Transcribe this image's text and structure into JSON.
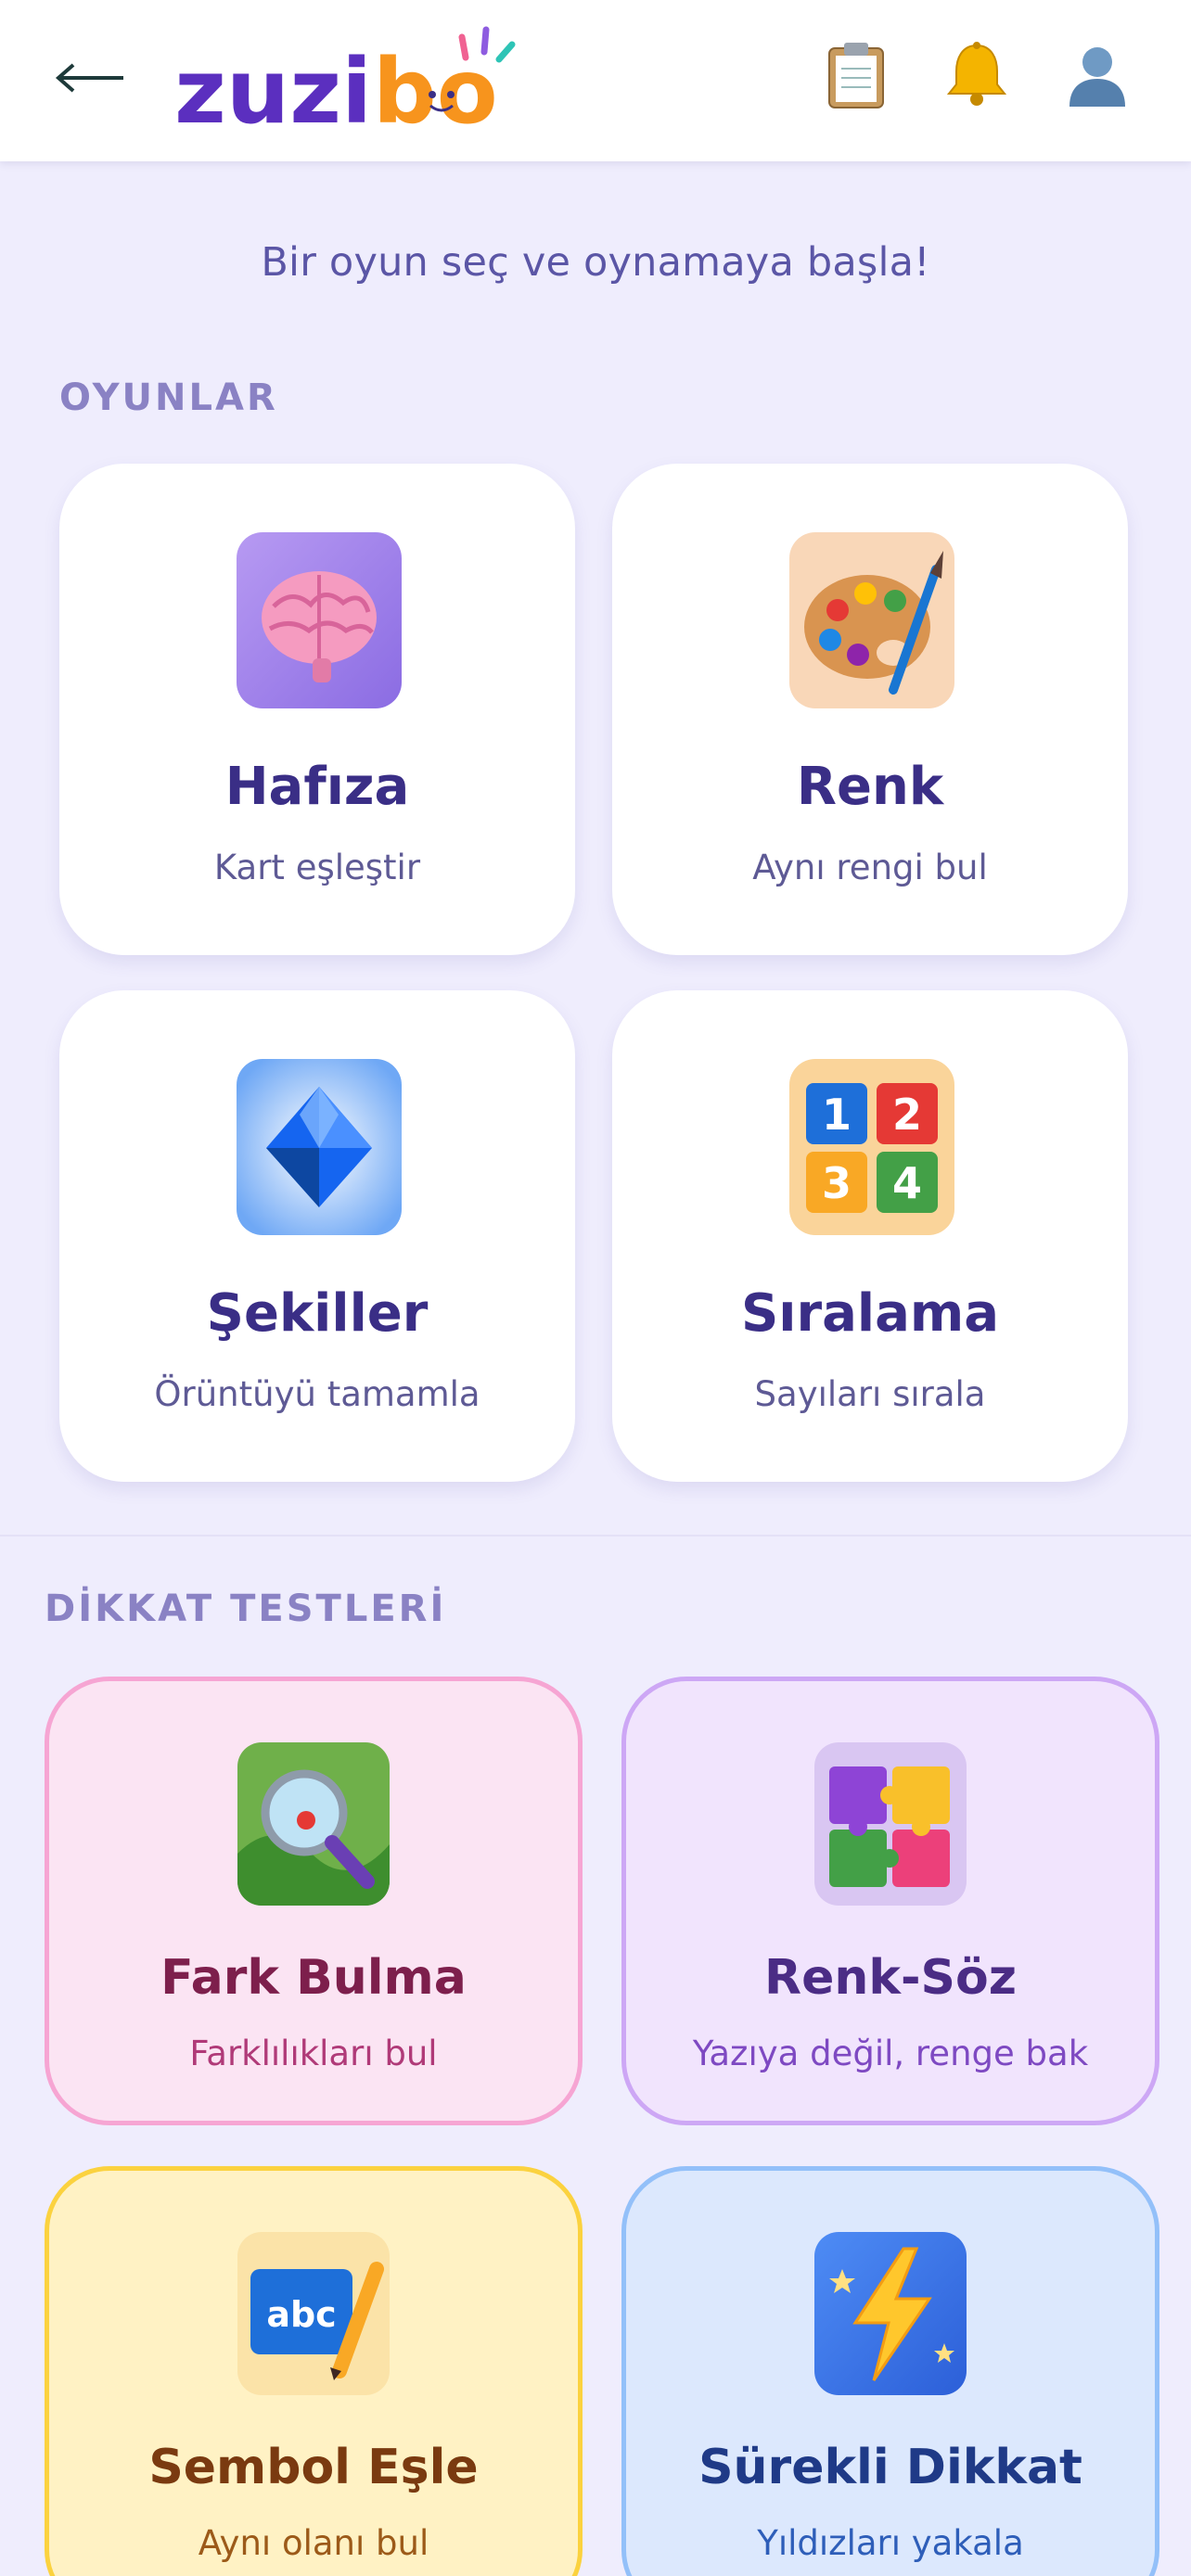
{
  "header": {
    "back_symbol": "←",
    "logo_text": "zuzibo",
    "icons": [
      "clipboard-icon",
      "bell-icon",
      "user-icon"
    ]
  },
  "subtitle": "Bir oyun seç ve oynamaya başla!",
  "sections": {
    "games_title": "OYUNLAR",
    "tests_title": "DİKKAT TESTLERİ"
  },
  "games": [
    {
      "title": "Hafıza",
      "desc": "Kart eşleştir",
      "icon": "brain-icon"
    },
    {
      "title": "Renk",
      "desc": "Aynı rengi bul",
      "icon": "palette-icon"
    },
    {
      "title": "Şekiller",
      "desc": "Örüntüyü tamamla",
      "icon": "diamond-icon"
    },
    {
      "title": "Sıralama",
      "desc": "Sayıları sırala",
      "icon": "number-blocks-icon"
    }
  ],
  "number_blocks": [
    "1",
    "2",
    "3",
    "4"
  ],
  "tests": [
    {
      "title": "Fark Bulma",
      "desc": "Farklılıkları bul",
      "icon": "magnifier-icon",
      "theme": "pink"
    },
    {
      "title": "Renk-Söz",
      "desc": "Yazıya değil, renge bak",
      "icon": "puzzle-icon",
      "theme": "purple"
    },
    {
      "title": "Sembol Eşle",
      "desc": "Aynı olanı bul",
      "icon": "abc-pencil-icon",
      "theme": "yellow"
    },
    {
      "title": "Sürekli Dikkat",
      "desc": "Yıldızları yakala",
      "icon": "lightning-icon",
      "theme": "blue"
    }
  ],
  "abc_label": "abc",
  "colors": {
    "background": "#EFEDFD",
    "logo_purple": "#5B2FBF",
    "logo_orange": "#F7941D",
    "title_purple": "#3A2E86"
  }
}
